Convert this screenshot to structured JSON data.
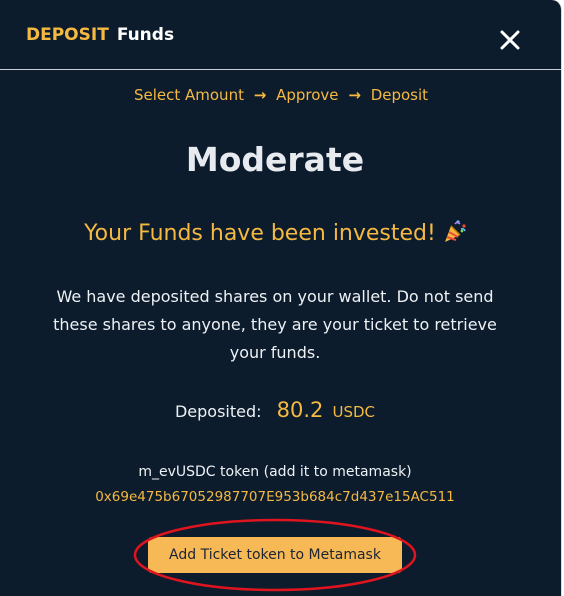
{
  "header": {
    "title_accent": "DEPOSIT",
    "title_main": "Funds",
    "close_icon": "close-icon"
  },
  "steps": {
    "step1": "Select Amount",
    "step2": "Approve",
    "step3": "Deposit",
    "separator_icon": "arrow-right-icon"
  },
  "strategy": {
    "name": "Moderate"
  },
  "status": {
    "message": "Your Funds have been invested!",
    "icon": "party-popper-icon"
  },
  "description": "We have deposited shares on your wallet. Do not send these shares to anyone, they are your ticket to retrieve your funds.",
  "deposit": {
    "label": "Deposited:",
    "amount": "80.2",
    "currency": "USDC"
  },
  "token": {
    "label": "m_evUSDC token (add it to metamask)",
    "address": "0x69e475b67052987707E953b684c7d437e15AC511"
  },
  "actions": {
    "add_token_label": "Add Ticket token to Metamask"
  },
  "colors": {
    "background": "#0c1c2d",
    "accent": "#f5b942",
    "button": "#f7b955",
    "annotation": "#e0141e"
  }
}
